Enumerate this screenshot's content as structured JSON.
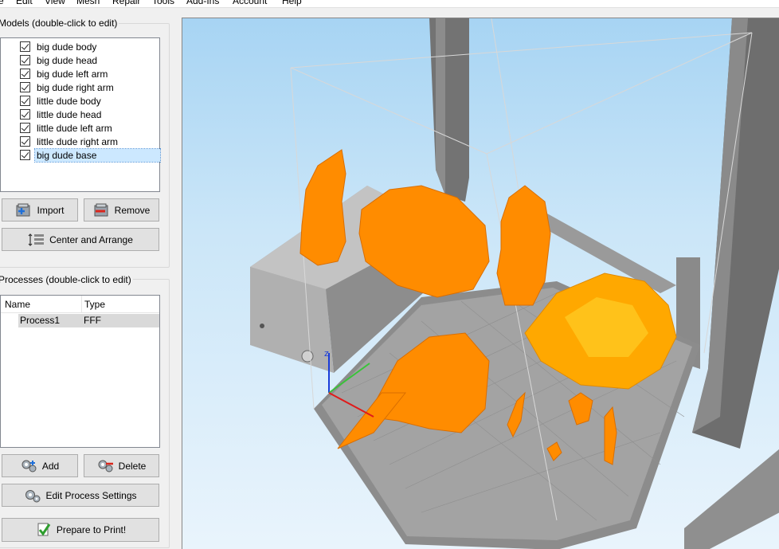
{
  "menu": [
    "e",
    "Edit",
    "View",
    "Mesh",
    "Repair",
    "Tools",
    "Add-Ins",
    "Account",
    "Help"
  ],
  "models_panel": {
    "title": "Models (double-click to edit)",
    "items": [
      {
        "label": "big dude body",
        "checked": true
      },
      {
        "label": "big dude head",
        "checked": true
      },
      {
        "label": "big dude left arm",
        "checked": true
      },
      {
        "label": "big dude right arm",
        "checked": true
      },
      {
        "label": "little dude body",
        "checked": true
      },
      {
        "label": "little dude head",
        "checked": true
      },
      {
        "label": "little dude left arm",
        "checked": true
      },
      {
        "label": "little dude right arm",
        "checked": true
      },
      {
        "label": "big dude base",
        "checked": true,
        "selected": true
      }
    ],
    "import_label": "Import",
    "remove_label": "Remove",
    "center_label": "Center and Arrange"
  },
  "processes_panel": {
    "title": "Processes (double-click to edit)",
    "col_name": "Name",
    "col_type": "Type",
    "rows": [
      {
        "name": "Process1",
        "type": "FFF"
      }
    ],
    "add_label": "Add",
    "delete_label": "Delete",
    "edit_label": "Edit Process Settings",
    "prepare_label": "Prepare to Print!"
  },
  "viewport": {
    "model_color": "#ff8c00",
    "selected_color": "#ffb000",
    "bed_color": "#8c8c8c",
    "frame_color": "#7a7a7a"
  }
}
